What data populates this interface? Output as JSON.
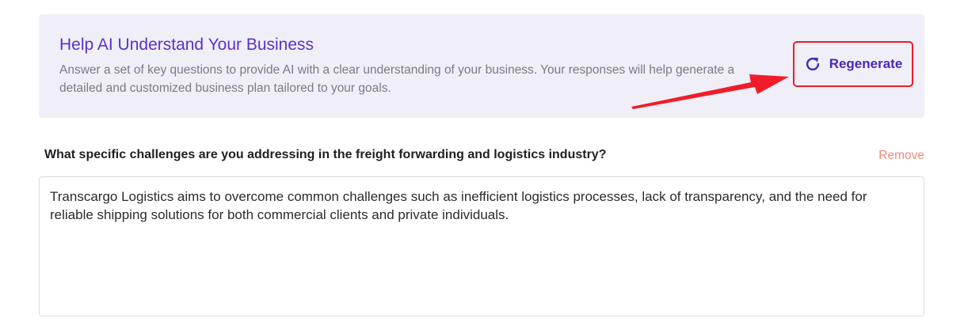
{
  "banner": {
    "title": "Help AI Understand Your Business",
    "description": "Answer a set of key questions to provide AI with a clear understanding of your business. Your responses will help generate a detailed and customized business plan tailored to your goals.",
    "regenerate_label": "Regenerate",
    "regenerate_icon": "refresh-icon"
  },
  "question": {
    "label": "What specific challenges are you addressing in the freight forwarding and logistics industry?",
    "remove_label": "Remove",
    "answer": "Transcargo Logistics aims to overcome common challenges such as inefficient logistics processes, lack of transparency, and the need for reliable shipping solutions for both commercial clients and private individuals."
  },
  "colors": {
    "accent": "#5b30c9",
    "banner_bg": "#f0eff8",
    "highlight_red": "#f01c2a",
    "remove": "#ef8a7b"
  }
}
